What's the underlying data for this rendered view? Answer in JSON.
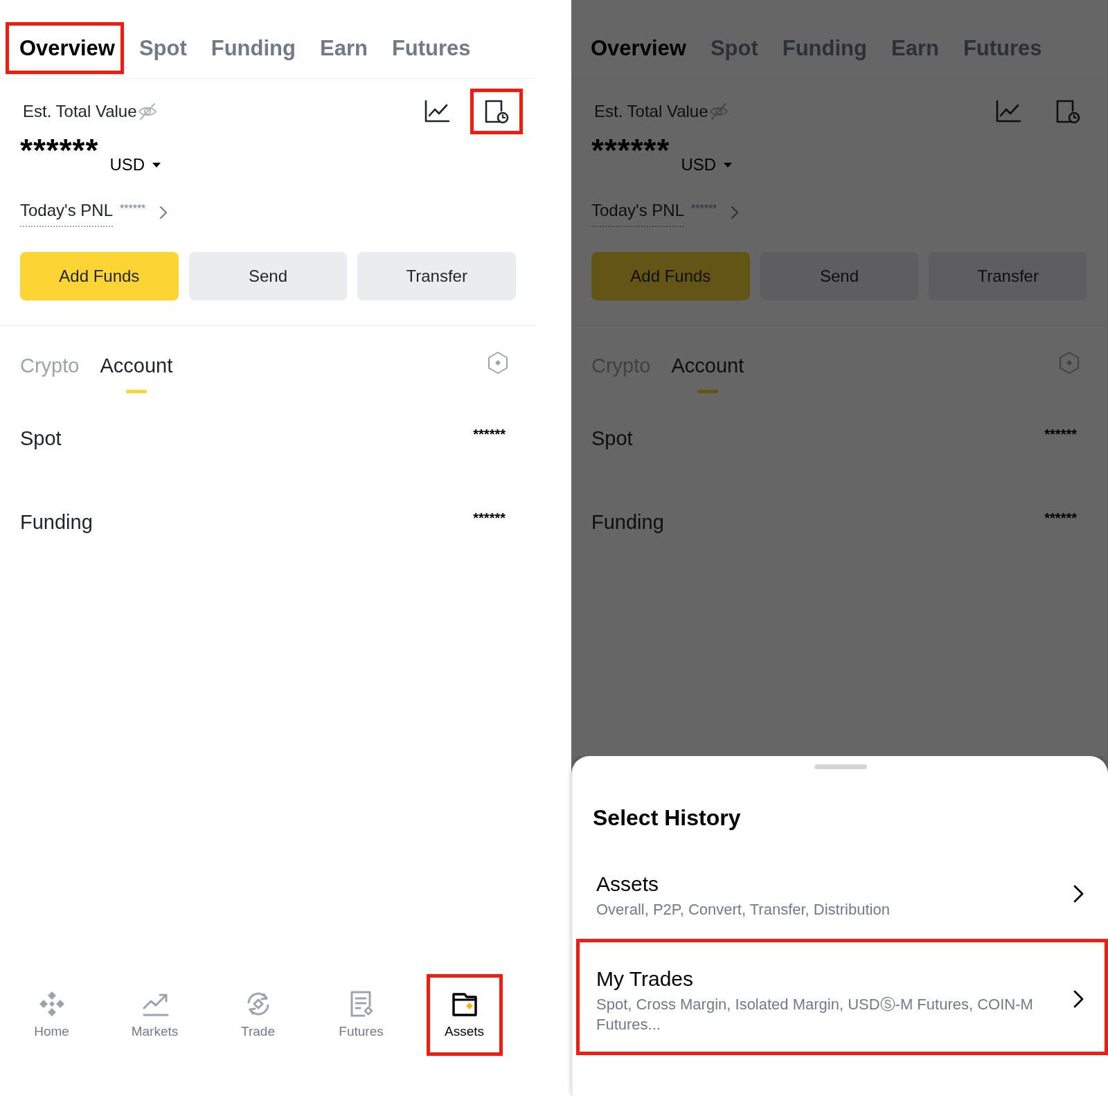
{
  "screens": [
    {
      "dimmed": false,
      "tabs": [
        {
          "label": "Overview",
          "selected": true,
          "highlighted": true
        },
        {
          "label": "Spot",
          "selected": false,
          "highlighted": false
        },
        {
          "label": "Funding",
          "selected": false,
          "highlighted": false
        },
        {
          "label": "Earn",
          "selected": false,
          "highlighted": false
        },
        {
          "label": "Futures",
          "selected": false,
          "highlighted": false
        }
      ],
      "total": {
        "label": "Est. Total Value",
        "value": "******",
        "currency": "USD"
      },
      "tools": [
        {
          "kind": "chart",
          "highlighted": false
        },
        {
          "kind": "history",
          "highlighted": true
        }
      ],
      "pnl": {
        "label": "Today's PNL",
        "value": "******"
      },
      "actions": [
        {
          "label": "Add Funds",
          "kind": "primary"
        },
        {
          "label": "Send",
          "kind": "secondary"
        },
        {
          "label": "Transfer",
          "kind": "secondary"
        }
      ],
      "subtabs": [
        {
          "label": "Crypto",
          "selected": false
        },
        {
          "label": "Account",
          "selected": true
        }
      ],
      "accounts": [
        {
          "name": "Spot",
          "value": "******"
        },
        {
          "name": "Funding",
          "value": "******"
        }
      ],
      "nav": [
        {
          "label": "Home",
          "kind": "home",
          "selected": false,
          "highlighted": false
        },
        {
          "label": "Markets",
          "kind": "markets",
          "selected": false,
          "highlighted": false
        },
        {
          "label": "Trade",
          "kind": "trade",
          "selected": false,
          "highlighted": false
        },
        {
          "label": "Futures",
          "kind": "futures",
          "selected": false,
          "highlighted": false
        },
        {
          "label": "Assets",
          "kind": "assets",
          "selected": true,
          "highlighted": true
        }
      ]
    },
    {
      "dimmed": true,
      "tabs": [
        {
          "label": "Overview",
          "selected": true,
          "highlighted": false
        },
        {
          "label": "Spot",
          "selected": false,
          "highlighted": false
        },
        {
          "label": "Funding",
          "selected": false,
          "highlighted": false
        },
        {
          "label": "Earn",
          "selected": false,
          "highlighted": false
        },
        {
          "label": "Futures",
          "selected": false,
          "highlighted": false
        }
      ],
      "total": {
        "label": "Est. Total Value",
        "value": "******",
        "currency": "USD"
      },
      "tools": [
        {
          "kind": "chart",
          "highlighted": false
        },
        {
          "kind": "history",
          "highlighted": false
        }
      ],
      "pnl": {
        "label": "Today's PNL",
        "value": "******"
      },
      "actions": [
        {
          "label": "Add Funds",
          "kind": "primary"
        },
        {
          "label": "Send",
          "kind": "secondary"
        },
        {
          "label": "Transfer",
          "kind": "secondary"
        }
      ],
      "subtabs": [
        {
          "label": "Crypto",
          "selected": false
        },
        {
          "label": "Account",
          "selected": true
        }
      ],
      "accounts": [
        {
          "name": "Spot",
          "value": "******"
        },
        {
          "name": "Funding",
          "value": "******"
        }
      ],
      "sheet": {
        "title": "Select History",
        "items": [
          {
            "title": "Assets",
            "subtitle": "Overall, P2P, Convert, Transfer, Distribution",
            "highlighted": false
          },
          {
            "title": "My Trades",
            "subtitle": "Spot, Cross Margin, Isolated Margin, USDⓈ-M Futures, COIN-M Futures...",
            "highlighted": true
          }
        ]
      }
    }
  ]
}
